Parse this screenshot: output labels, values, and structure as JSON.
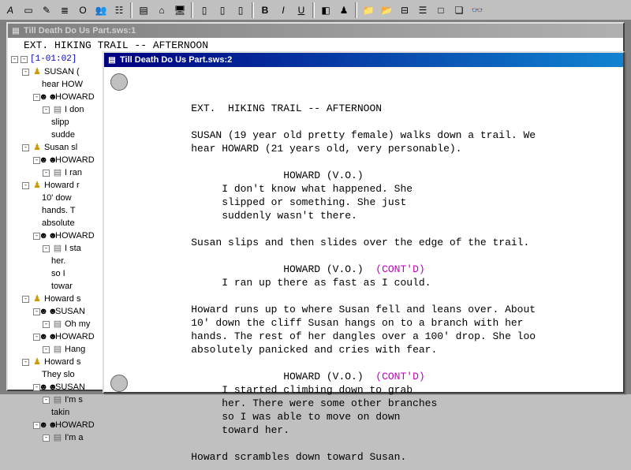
{
  "toolbar": {
    "buttons": [
      {
        "name": "font-a-icon",
        "glyph": "A",
        "cls": "italic"
      },
      {
        "name": "new-doc-icon",
        "glyph": "▭"
      },
      {
        "name": "person-yellow-icon",
        "glyph": "✎"
      },
      {
        "name": "doc-lines-icon",
        "glyph": "≣"
      },
      {
        "name": "paren-o-icon",
        "glyph": "O"
      },
      {
        "name": "people-icon",
        "glyph": "👥"
      },
      {
        "name": "doc-text-icon",
        "glyph": "☷"
      },
      {
        "name": "sep"
      },
      {
        "name": "green-doc-icon",
        "glyph": "▤"
      },
      {
        "name": "home-icon",
        "glyph": "⌂"
      },
      {
        "name": "pc-icon",
        "glyph": "🖥"
      },
      {
        "name": "sep"
      },
      {
        "name": "page1-icon",
        "glyph": "▯"
      },
      {
        "name": "page2-icon",
        "glyph": "▯"
      },
      {
        "name": "page3-icon",
        "glyph": "▯"
      },
      {
        "name": "sep"
      },
      {
        "name": "bold-icon",
        "glyph": "B",
        "cls": "bold"
      },
      {
        "name": "italic-icon",
        "glyph": "I",
        "cls": "italic"
      },
      {
        "name": "underline-icon",
        "glyph": "U",
        "cls": "underline"
      },
      {
        "name": "sep"
      },
      {
        "name": "paint-icon",
        "glyph": "◧"
      },
      {
        "name": "user-icon",
        "glyph": "♟"
      },
      {
        "name": "sep"
      },
      {
        "name": "folder-icon",
        "glyph": "📁"
      },
      {
        "name": "folder2-icon",
        "glyph": "📂"
      },
      {
        "name": "card-icon",
        "glyph": "⊟"
      },
      {
        "name": "list-icon",
        "glyph": "☰"
      },
      {
        "name": "blank-icon",
        "glyph": "□"
      },
      {
        "name": "find-icon",
        "glyph": "❏"
      },
      {
        "name": "binoc-icon",
        "glyph": "👓"
      }
    ]
  },
  "win1": {
    "title": "Till Death Do Us Part.sws:1",
    "scene_header_top": "EXT.  HIKING TRAIL -- AFTERNOON"
  },
  "tree": {
    "scene": "[1-01:02]",
    "nodes": [
      {
        "lvl": 1,
        "exp": "-",
        "icon": "person",
        "text": "SUSAN ("
      },
      {
        "lvl": 2,
        "exp": "",
        "icon": "",
        "text": "hear HOW"
      },
      {
        "lvl": 2,
        "exp": "-",
        "icon": "heads",
        "text": "HOWARD"
      },
      {
        "lvl": 3,
        "exp": "-",
        "icon": "doc",
        "text": "I don"
      },
      {
        "lvl": 3,
        "exp": "",
        "icon": "",
        "text": "slipp"
      },
      {
        "lvl": 3,
        "exp": "",
        "icon": "",
        "text": "sudde"
      },
      {
        "lvl": 1,
        "exp": "-",
        "icon": "person",
        "text": "Susan sl"
      },
      {
        "lvl": 2,
        "exp": "-",
        "icon": "heads",
        "text": "HOWARD"
      },
      {
        "lvl": 3,
        "exp": "-",
        "icon": "doc",
        "text": "I ran"
      },
      {
        "lvl": 1,
        "exp": "-",
        "icon": "person",
        "text": "Howard r"
      },
      {
        "lvl": 2,
        "exp": "",
        "icon": "",
        "text": "10' dow"
      },
      {
        "lvl": 2,
        "exp": "",
        "icon": "",
        "text": "hands. T"
      },
      {
        "lvl": 2,
        "exp": "",
        "icon": "",
        "text": "absolute"
      },
      {
        "lvl": 2,
        "exp": "-",
        "icon": "heads",
        "text": "HOWARD"
      },
      {
        "lvl": 3,
        "exp": "-",
        "icon": "doc",
        "text": "I sta"
      },
      {
        "lvl": 3,
        "exp": "",
        "icon": "",
        "text": "her."
      },
      {
        "lvl": 3,
        "exp": "",
        "icon": "",
        "text": "so I"
      },
      {
        "lvl": 3,
        "exp": "",
        "icon": "",
        "text": "towar"
      },
      {
        "lvl": 1,
        "exp": "-",
        "icon": "person",
        "text": "Howard s"
      },
      {
        "lvl": 2,
        "exp": "-",
        "icon": "heads",
        "text": "SUSAN"
      },
      {
        "lvl": 3,
        "exp": "-",
        "icon": "doc",
        "text": "Oh my"
      },
      {
        "lvl": 2,
        "exp": "-",
        "icon": "heads",
        "text": "HOWARD"
      },
      {
        "lvl": 3,
        "exp": "-",
        "icon": "doc",
        "text": "Hang"
      },
      {
        "lvl": 1,
        "exp": "-",
        "icon": "person",
        "text": "Howard s"
      },
      {
        "lvl": 2,
        "exp": "",
        "icon": "",
        "text": "They slo"
      },
      {
        "lvl": 2,
        "exp": "-",
        "icon": "heads",
        "text": "SUSAN"
      },
      {
        "lvl": 3,
        "exp": "-",
        "icon": "doc",
        "text": "I'm s"
      },
      {
        "lvl": 3,
        "exp": "",
        "icon": "",
        "text": "takin"
      },
      {
        "lvl": 2,
        "exp": "-",
        "icon": "heads",
        "text": "HOWARD"
      },
      {
        "lvl": 3,
        "exp": "-",
        "icon": "doc",
        "text": "I'm a"
      }
    ]
  },
  "win2": {
    "title": "Till Death Do Us Part.sws:2",
    "scene_header": "EXT.  HIKING TRAIL -- AFTERNOON",
    "action1a": "SUSAN (19 year old pretty female) walks down a trail. We",
    "action1b": "hear HOWARD (21 years old, very personable).",
    "char1": "HOWARD (V.O.)",
    "dlg1a": "I don't know what happened. She",
    "dlg1b": "slipped or something. She just",
    "dlg1c": "suddenly wasn't there.",
    "action2": "Susan slips and then slides over the edge of the trail.",
    "char2": "HOWARD (V.O.)",
    "contd2": "(CONT'D)",
    "dlg2": "I ran up there as fast as I could.",
    "action3a": "Howard runs up to where Susan fell and leans over. About",
    "action3b": "10' down the cliff Susan hangs on to a branch with her",
    "action3c": "hands. The rest of her dangles over a 100' drop. She loo",
    "action3d": "absolutely panicked and cries with fear.",
    "char3": "HOWARD (V.O.)",
    "contd3": "(CONT'D)",
    "dlg3a": "I started climbing down to grab",
    "dlg3b": "her. There were some other branches",
    "dlg3c": "so I was able to move on down",
    "dlg3d": "toward her.",
    "action4": "Howard scrambles down toward Susan."
  }
}
